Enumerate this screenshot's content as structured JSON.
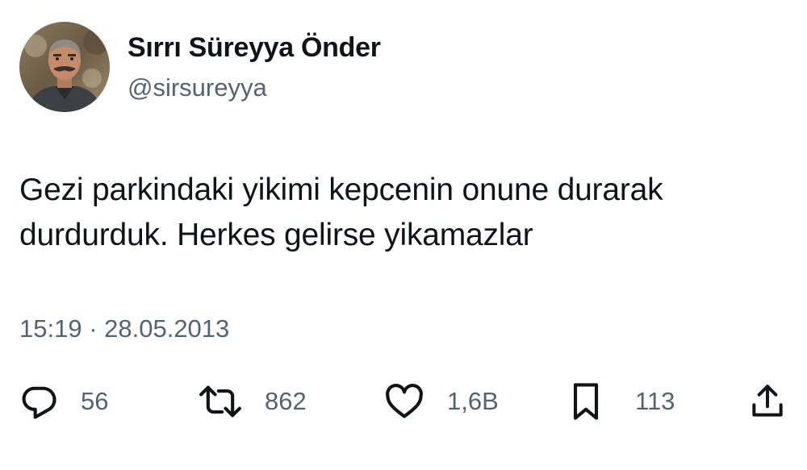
{
  "author": {
    "display_name": "Sırrı Süreyya Önder",
    "handle": "@sirsureyya"
  },
  "tweet": {
    "text_line1": "Gezi parkindaki yikimi kepcenin onune durarak",
    "text_line2": "durdurduk. Herkes gelirse yikamazlar",
    "timestamp": "15:19 · 28.05.2013"
  },
  "actions": {
    "replies": "56",
    "retweets": "862",
    "likes": "1,6B",
    "bookmarks": "113"
  },
  "icons": {
    "reply": "reply-icon",
    "retweet": "retweet-icon",
    "like": "heart-icon",
    "bookmark": "bookmark-icon",
    "share": "share-icon"
  },
  "colors": {
    "text": "#0f1419",
    "secondary": "#536471",
    "background": "#ffffff"
  }
}
